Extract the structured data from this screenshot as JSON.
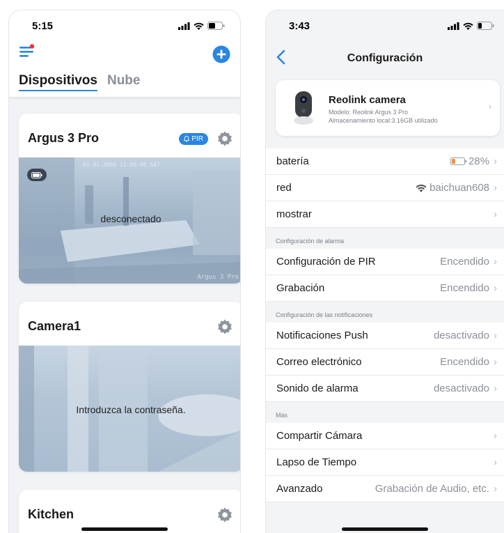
{
  "left": {
    "time": "5:15",
    "tabs": {
      "active": "Dispositivos",
      "other": "Nube"
    },
    "devices": [
      {
        "name": "Argus 3 Pro",
        "badge": "PIR",
        "message": "desconectado",
        "overlay_time": "01-01-2000 12:00:00 SAT",
        "watermark": "Argus 3 Pro"
      },
      {
        "name": "Camera1",
        "message": "Introduzca la contraseña."
      },
      {
        "name": "Kitchen"
      }
    ]
  },
  "right": {
    "time": "3:43",
    "title": "Configuración",
    "camera": {
      "name": "Reolink camera",
      "model": "Modelo: Reolink Argus 3 Pro",
      "storage": "Almacenamiento local:3.16GB utilizado"
    },
    "rows_main": [
      {
        "label": "batería",
        "value": "28%"
      },
      {
        "label": "red",
        "value": "baichuan608"
      },
      {
        "label": "mostrar",
        "value": ""
      }
    ],
    "section_alarm": "Configuración de alarma",
    "rows_alarm": [
      {
        "label": "Configuración de PIR",
        "value": "Encendido"
      },
      {
        "label": "Grabación",
        "value": "Encendido"
      }
    ],
    "section_notif": "Configuración de las notificaciones",
    "rows_notif": [
      {
        "label": "Notificaciones Push",
        "value": "desactivado"
      },
      {
        "label": "Correo electrónico",
        "value": "Encendido"
      },
      {
        "label": "Sonido de alarma",
        "value": "desactivado"
      }
    ],
    "section_more": "Más",
    "rows_more": [
      {
        "label": "Compartir Cámara",
        "value": ""
      },
      {
        "label": "Lapso de Tiempo",
        "value": ""
      },
      {
        "label": "Avanzado",
        "value": "Grabación de Audio, etc."
      }
    ]
  },
  "colors": {
    "accent": "#2a86e0",
    "battery_low": "#f2913c",
    "menu_dot": "#e53935"
  },
  "battery_level": 0.28
}
